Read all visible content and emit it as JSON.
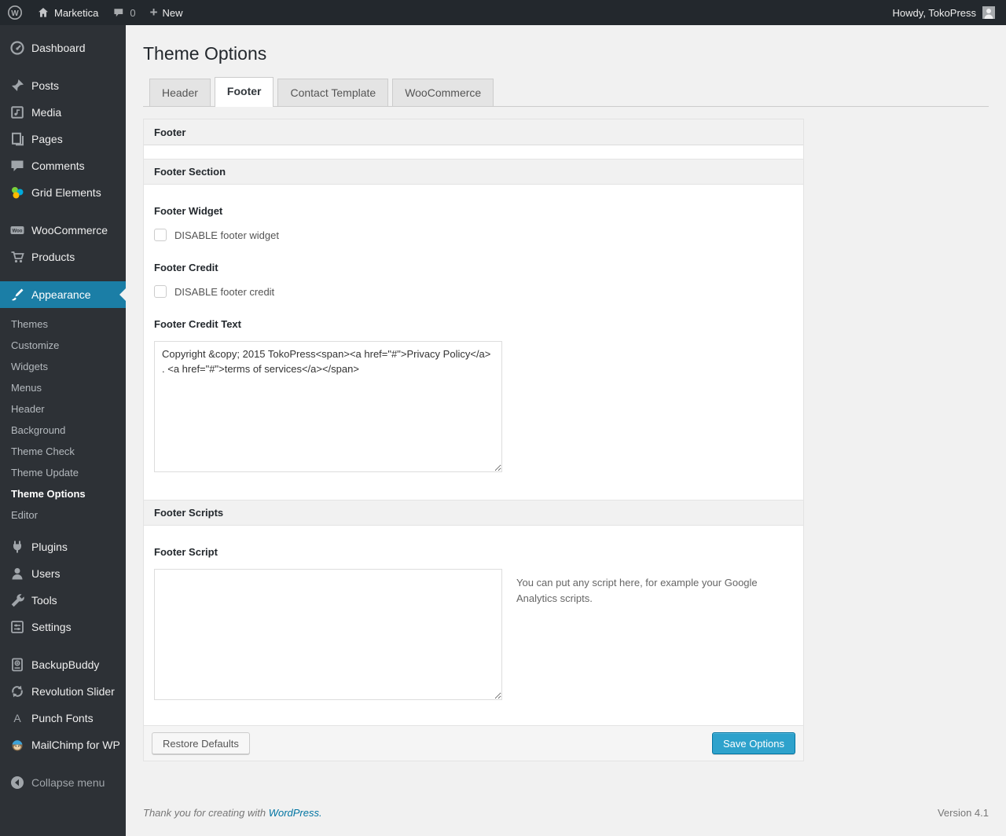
{
  "colors": {
    "accent_blue": "#2ea2cc",
    "accent_blue_border": "#0074a2",
    "menu_highlight": "#1b7ea6",
    "admin_bar_bg": "#23282d",
    "sidebar_bg": "#2d3136"
  },
  "admin_bar": {
    "wp_logo_letter": "W",
    "site_name": "Marketica",
    "comment_count": "0",
    "new_label": "New",
    "howdy": "Howdy, TokoPress"
  },
  "sidebar": {
    "items": [
      {
        "label": "Dashboard",
        "icon": "dashboard-gauge-icon"
      },
      {
        "label": "Posts",
        "icon": "pushpin-icon"
      },
      {
        "label": "Media",
        "icon": "media-note-icon"
      },
      {
        "label": "Pages",
        "icon": "pages-stack-icon"
      },
      {
        "label": "Comments",
        "icon": "comment-bubble-icon"
      },
      {
        "label": "Grid Elements",
        "icon": "grid-elements-pinwheel-icon"
      },
      {
        "label": "WooCommerce",
        "icon": "woocommerce-badge-icon"
      },
      {
        "label": "Products",
        "icon": "cart-icon"
      },
      {
        "label": "Appearance",
        "icon": "paintbrush-icon"
      },
      {
        "label": "Plugins",
        "icon": "plug-icon"
      },
      {
        "label": "Users",
        "icon": "person-icon"
      },
      {
        "label": "Tools",
        "icon": "wrench-icon"
      },
      {
        "label": "Settings",
        "icon": "sliders-icon"
      },
      {
        "label": "BackupBuddy",
        "icon": "backup-drive-icon"
      },
      {
        "label": "Revolution Slider",
        "icon": "rotate-arrows-icon"
      },
      {
        "label": "Punch Fonts",
        "icon": "letter-a-icon"
      },
      {
        "label": "MailChimp for WP",
        "icon": "monkey-icon"
      },
      {
        "label": "Collapse menu",
        "icon": "collapse-arrow-icon"
      }
    ],
    "woo_badge_text": "Woo",
    "punch_fonts_letter": "A",
    "appearance_submenu": {
      "items": [
        "Themes",
        "Customize",
        "Widgets",
        "Menus",
        "Header",
        "Background",
        "Theme Check",
        "Theme Update",
        "Theme Options",
        "Editor"
      ],
      "current": "Theme Options"
    }
  },
  "page": {
    "title": "Theme Options",
    "tabs": [
      {
        "label": "Header",
        "active": false
      },
      {
        "label": "Footer",
        "active": true
      },
      {
        "label": "Contact Template",
        "active": false
      },
      {
        "label": "WooCommerce",
        "active": false
      }
    ]
  },
  "panel": {
    "box_header": "Footer",
    "footer_section_header": "Footer Section",
    "footer_scripts_header": "Footer Scripts",
    "fields": {
      "footer_widget": {
        "label": "Footer Widget",
        "checkbox_label": "DISABLE footer widget",
        "checked": false
      },
      "footer_credit": {
        "label": "Footer Credit",
        "checkbox_label": "DISABLE footer credit",
        "checked": false
      },
      "footer_credit_text": {
        "label": "Footer Credit Text",
        "value": "Copyright &copy; 2015 TokoPress<span><a href=\"#\">Privacy Policy</a> . <a href=\"#\">terms of services</a></span>"
      },
      "footer_script": {
        "label": "Footer Script",
        "value": "",
        "help": "You can put any script here, for example your Google Analytics scripts."
      }
    },
    "buttons": {
      "restore": "Restore Defaults",
      "save": "Save Options"
    }
  },
  "page_footer": {
    "thanks_prefix": "Thank you for creating with ",
    "wordpress_link": "WordPress.",
    "version": "Version 4.1"
  }
}
